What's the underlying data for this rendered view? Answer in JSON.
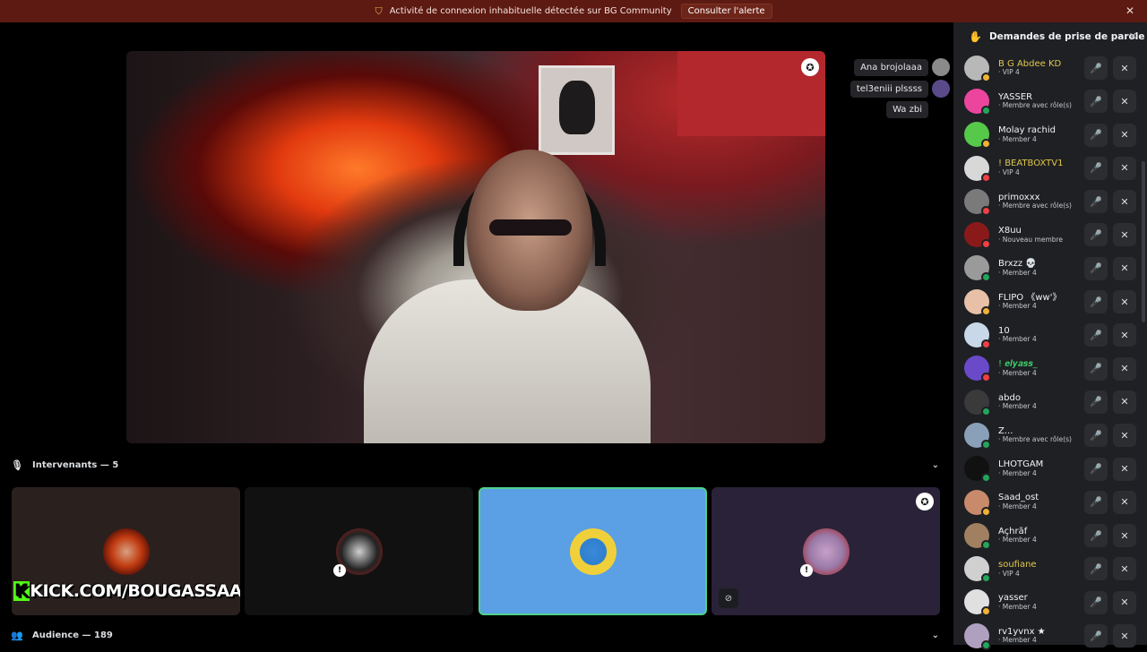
{
  "alert": {
    "text": "Activité de connexion inhabituelle détectée sur BG Community",
    "button": "Consulter l'alerte",
    "icon": "shield-warning-icon",
    "close_icon": "close-icon",
    "bg_color": "#5c1a12"
  },
  "chat_overlay": {
    "messages": [
      {
        "text": "Ana brojolaaa"
      },
      {
        "text": "tel3eniii plssss"
      },
      {
        "text": "Wa zbi"
      }
    ]
  },
  "speakers": {
    "label": "Intervenants — 5",
    "tiles": [
      {
        "overlay_text": "KICK.COM/BOUGASSAA",
        "kick_letter": "K",
        "bg": "#2a211f"
      },
      {
        "bg": "#111111"
      },
      {
        "bg": "#5b9fe4",
        "active": true,
        "border": "#4fd18a"
      },
      {
        "bg": "#2a2238"
      }
    ]
  },
  "audience": {
    "label": "Audience — 189"
  },
  "sidebar": {
    "title": "Demandes de prise de parole",
    "requests": [
      {
        "name": "B G Abdee KD",
        "role": "VIP 4",
        "name_color": "#e0c84a",
        "avatar": "#b8b8b8",
        "status": "#f0b232"
      },
      {
        "name": "YASSER",
        "role": "Membre avec rôle(s)",
        "name_color": "#f2f3f5",
        "avatar": "#eb459e",
        "status": "#23a55a"
      },
      {
        "name": "Molay rachid",
        "role": "Member 4",
        "name_color": "#f2f3f5",
        "avatar": "#56c84a",
        "status": "#f0b232"
      },
      {
        "name": "! BEATBOXTV1",
        "role": "VIP 4",
        "name_color": "#e0c84a",
        "avatar": "#d8d8d8",
        "status": "#f23f43"
      },
      {
        "name": "primoxxx",
        "role": "Membre avec rôle(s)",
        "name_color": "#f2f3f5",
        "avatar": "#7a7a7a",
        "status": "#f23f43"
      },
      {
        "name": "X8uu",
        "role": "Nouveau membre",
        "name_color": "#f2f3f5",
        "avatar": "#8a1a1a",
        "status": "#f23f43"
      },
      {
        "name": "Brxzz 💀",
        "role": "Member 4",
        "name_color": "#f2f3f5",
        "avatar": "#9a9a9a",
        "status": "#23a55a"
      },
      {
        "name": "FLIPO 《ᴡᴡ'》",
        "role": "Member 4",
        "name_color": "#f2f3f5",
        "avatar": "#e8c0a8",
        "status": "#f0b232"
      },
      {
        "name": "10",
        "role": "Member 4",
        "name_color": "#f2f3f5",
        "avatar": "#c8d8e8",
        "status": "#f23f43"
      },
      {
        "name": "! 𝒆𝒍𝒚𝒂𝒔𝒔_",
        "role": "Member 4",
        "name_color": "#3ed46a",
        "avatar": "#6a4ac8",
        "status": "#f23f43"
      },
      {
        "name": "abdo",
        "role": "Member 4",
        "name_color": "#f2f3f5",
        "avatar": "#3a3a3a",
        "status": "#23a55a"
      },
      {
        "name": "Z...",
        "role": "Membre avec rôle(s)",
        "name_color": "#f2f3f5",
        "avatar": "#8aa0b8",
        "status": "#23a55a"
      },
      {
        "name": "LHOTGAM",
        "role": "Member 4",
        "name_color": "#f2f3f5",
        "avatar": "#111111",
        "status": "#23a55a"
      },
      {
        "name": "Saad_ost",
        "role": "Member 4",
        "name_color": "#f2f3f5",
        "avatar": "#c88a6a",
        "status": "#f0b232"
      },
      {
        "name": "Açhrãf",
        "role": "Member 4",
        "name_color": "#f2f3f5",
        "avatar": "#a08060",
        "status": "#23a55a"
      },
      {
        "name": "soufiane",
        "role": "VIP 4",
        "name_color": "#e0c84a",
        "avatar": "#d0d0d0",
        "status": "#23a55a"
      },
      {
        "name": "yasser",
        "role": "Member 4",
        "name_color": "#f2f3f5",
        "avatar": "#e0e0e0",
        "status": "#f0b232"
      },
      {
        "name": "rv1yvnx ★",
        "role": "Member 4",
        "name_color": "#f2f3f5",
        "avatar": "#b0a0c0",
        "status": "#23a55a"
      }
    ]
  }
}
